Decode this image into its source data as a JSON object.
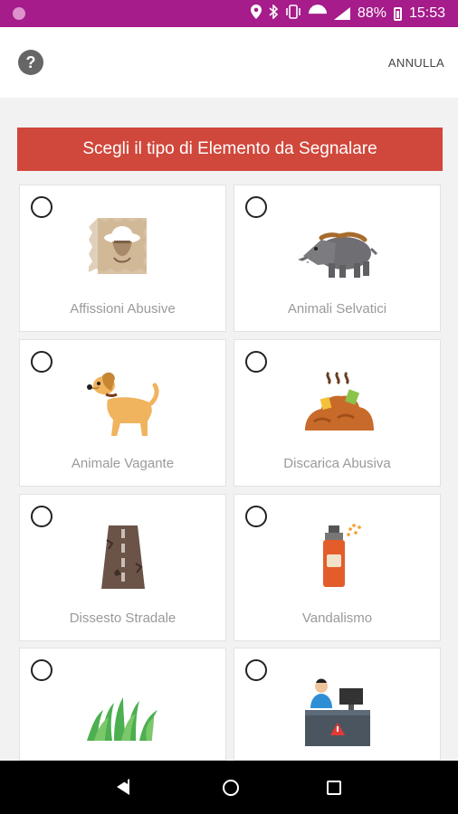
{
  "status_bar": {
    "battery_percent": "88%",
    "time": "15:53",
    "icons": [
      "location-icon",
      "bluetooth-icon",
      "vibrate-icon",
      "wifi-icon",
      "signal-icon",
      "battery-icon"
    ]
  },
  "toolbar": {
    "help_icon_glyph": "?",
    "cancel_label": "ANNULLA"
  },
  "banner": {
    "title": "Scegli il tipo di Elemento da Segnalare",
    "color": "#d0473b"
  },
  "categories": [
    {
      "label": "Affissioni Abusive",
      "icon": "poster-icon",
      "selected": false
    },
    {
      "label": "Animali Selvatici",
      "icon": "boar-icon",
      "selected": false
    },
    {
      "label": "Animale Vagante",
      "icon": "dog-icon",
      "selected": false
    },
    {
      "label": "Discarica Abusiva",
      "icon": "garbage-pile-icon",
      "selected": false
    },
    {
      "label": "Dissesto Stradale",
      "icon": "damaged-road-icon",
      "selected": false
    },
    {
      "label": "Vandalismo",
      "icon": "spray-can-icon",
      "selected": false
    },
    {
      "label": "",
      "icon": "grass-icon",
      "selected": false
    },
    {
      "label": "",
      "icon": "office-desk-icon",
      "selected": false
    }
  ],
  "colors": {
    "status_bar": "#a51c8a",
    "accent": "#d0473b"
  }
}
